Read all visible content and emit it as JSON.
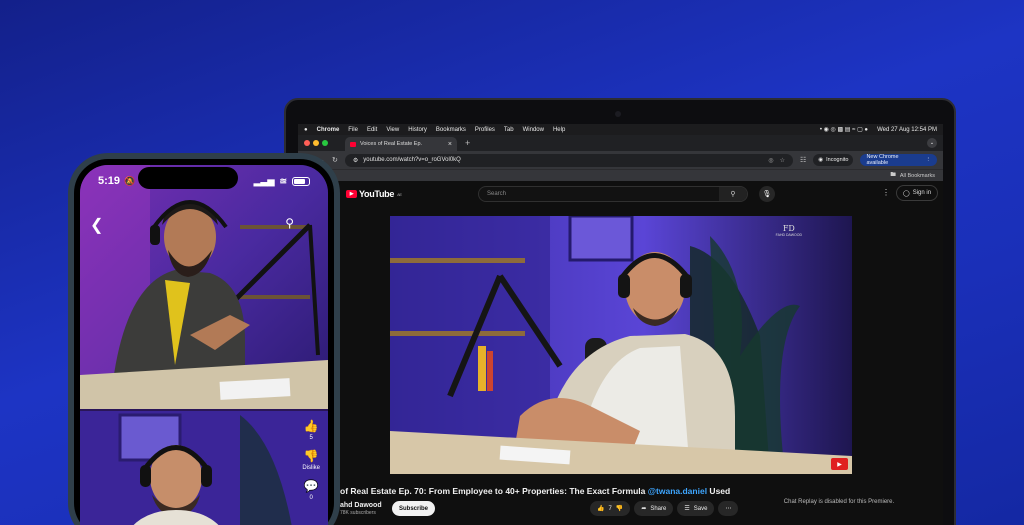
{
  "mac_menubar": {
    "app": "Chrome",
    "menus": [
      "File",
      "Edit",
      "View",
      "History",
      "Bookmarks",
      "Profiles",
      "Tab",
      "Window",
      "Help"
    ],
    "datetime": "Wed 27 Aug  12:54 PM"
  },
  "browser": {
    "tab_title": "Voices of Real Estate Ep.",
    "new_tab": "+",
    "url": "youtube.com/watch?v=o_roGVol0kQ",
    "incognito": "Incognito",
    "new_chrome": "New Chrome available",
    "bookmarks": "All Bookmarks"
  },
  "youtube": {
    "logo": "YouTube",
    "logo_sup": "AE",
    "search_placeholder": "Search",
    "sign_in": "Sign in",
    "watermark": "FD",
    "watermark_sub": "FAHD DAWOOD",
    "video_title_prefix": "of Real Estate Ep. 70: From Employee to 40+ Properties: The Exact Formula ",
    "video_title_link": "@twana.daniel",
    "video_title_suffix": " Used",
    "channel_name": "ahd Dawood",
    "subscribers": "78K subscribers",
    "subscribe": "Subscribe",
    "likes": "7",
    "share": "Share",
    "save": "Save",
    "chat_replay": "Chat Replay is disabled for this Premiere."
  },
  "phone": {
    "time": "5:19",
    "likes": "5",
    "dislike": "Dislike",
    "comments": "0"
  },
  "colors": {
    "youtube_red": "#ff0033",
    "link": "#3ea6ff",
    "bg_blue": "#1d34c4"
  }
}
